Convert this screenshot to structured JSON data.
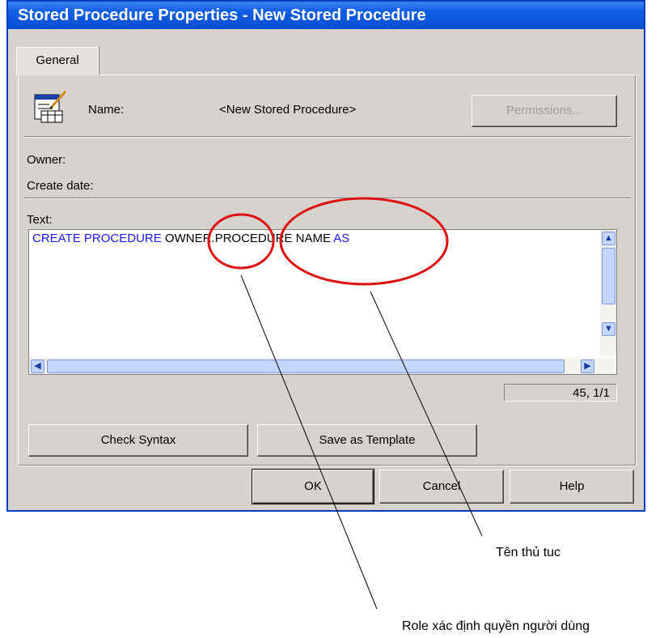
{
  "window": {
    "title": "Stored Procedure Properties - New Stored Procedure"
  },
  "tabs": [
    {
      "label": "General"
    }
  ],
  "general": {
    "name_label": "Name:",
    "name_value": "<New Stored Procedure>",
    "permissions_button": "Permissions...",
    "owner_label": "Owner:",
    "create_date_label": "Create date:",
    "text_label": "Text:"
  },
  "code": {
    "keyword1": "CREATE PROCEDURE ",
    "owner": "OWNER",
    "dot": ".",
    "procedure_name": "PROCEDURE NAME",
    "keyword2": "AS"
  },
  "status": {
    "cursor_position": "45, 1/1"
  },
  "buttons": {
    "check_syntax": "Check Syntax",
    "save_as_template": "Save as Template",
    "ok": "OK",
    "cancel": "Cancel",
    "help": "Help"
  },
  "annotations": {
    "procedure_name_note": "Tên thủ tuc",
    "owner_note": "Role xác định quyền người dùng"
  },
  "colors": {
    "title_bar": "#0a4fd3",
    "keyword": "#1a1aff",
    "annotation_circle": "#e01010"
  },
  "icons": [
    "stored-procedure-icon",
    "scroll-up-icon",
    "scroll-down-icon",
    "scroll-left-icon",
    "scroll-right-icon"
  ]
}
